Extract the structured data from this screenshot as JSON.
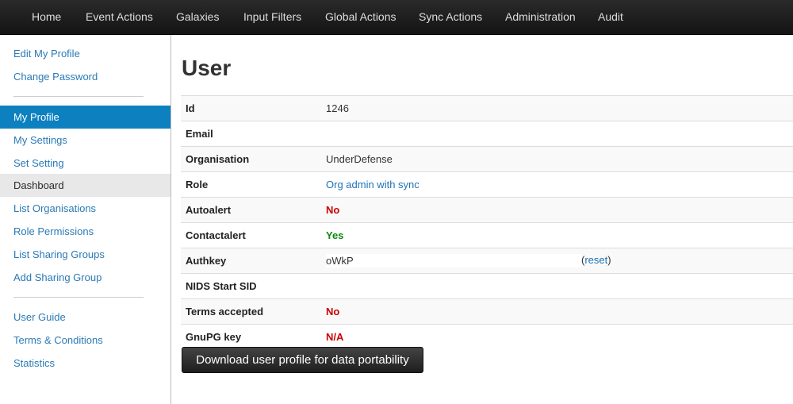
{
  "topnav": {
    "items": [
      "Home",
      "Event Actions",
      "Galaxies",
      "Input Filters",
      "Global Actions",
      "Sync Actions",
      "Administration",
      "Audit"
    ]
  },
  "sidebar": {
    "group1": [
      "Edit My Profile",
      "Change Password"
    ],
    "group2": [
      "My Profile",
      "My Settings",
      "Set Setting",
      "Dashboard",
      "List Organisations",
      "Role Permissions",
      "List Sharing Groups",
      "Add Sharing Group"
    ],
    "group3": [
      "User Guide",
      "Terms & Conditions",
      "Statistics"
    ],
    "active_item": "My Profile",
    "hover_item": "Dashboard"
  },
  "page": {
    "title": "User"
  },
  "profile": {
    "rows": [
      {
        "label": "Id",
        "value": "1246"
      },
      {
        "label": "Email",
        "value": ""
      },
      {
        "label": "Organisation",
        "value": "UnderDefense"
      },
      {
        "label": "Role",
        "value": "Org admin with sync"
      },
      {
        "label": "Autoalert",
        "value": "No"
      },
      {
        "label": "Contactalert",
        "value": "Yes"
      },
      {
        "label": "Authkey",
        "value": "oWkP",
        "reset_open": "(",
        "reset_label": "reset",
        "reset_close": ")"
      },
      {
        "label": "NIDS Start SID",
        "value": ""
      },
      {
        "label": "Terms accepted",
        "value": "No"
      },
      {
        "label": "GnuPG key",
        "value": "N/A"
      }
    ]
  },
  "actions": {
    "download_label": "Download user profile for data portability"
  },
  "colors": {
    "topbar": "#1b1b1b",
    "link": "#1d73b4",
    "active_bg": "#0d80c0",
    "negative": "#cc0000",
    "positive": "#118811"
  }
}
